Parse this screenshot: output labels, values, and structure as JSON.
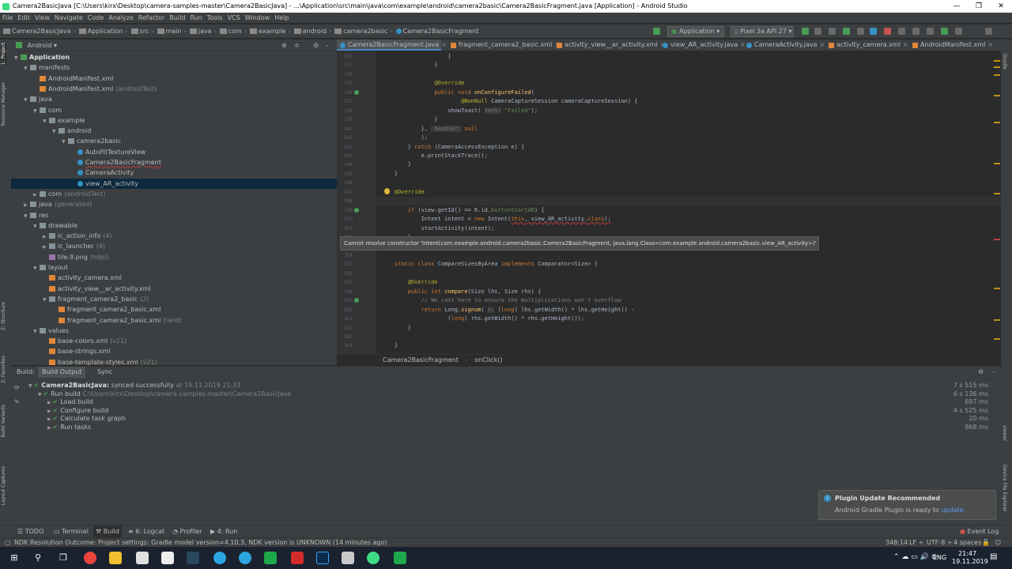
{
  "window": {
    "title": "Camera2BasicJava [C:\\Users\\kirx\\Desktop\\camera-samples-master\\Camera2BasicJava] - ...\\Application\\src\\main\\java\\com\\example\\android\\camera2basic\\Camera2BasicFragment.java [Application] - Android Studio",
    "minimize": "—",
    "maximize": "❐",
    "close": "✕"
  },
  "menu": [
    "File",
    "Edit",
    "View",
    "Navigate",
    "Code",
    "Analyze",
    "Refactor",
    "Build",
    "Run",
    "Tools",
    "VCS",
    "Window",
    "Help"
  ],
  "breadcrumbs": [
    "Camera2BasicJava",
    "Application",
    "src",
    "main",
    "java",
    "com",
    "example",
    "android",
    "camera2basic",
    "Camera2BasicFragment"
  ],
  "toolbar": {
    "run_config": "Application",
    "device": "Pixel 3a API 27"
  },
  "left_strip": {
    "project": "1: Project",
    "resource_manager": "Resource Manager",
    "structure": "Z: Structure",
    "favorites": "2: Favorites",
    "build_variants": "Build Variants",
    "layout_captures": "Layout Captures"
  },
  "right_strip": {
    "gradle": "Gradle",
    "viewer": "viewer",
    "device_file": "Device File Explorer"
  },
  "project": {
    "view": "Android",
    "tree": [
      {
        "label": "Application",
        "depth": 0,
        "bold": true,
        "arrow": "▼",
        "icon": "module"
      },
      {
        "label": "manifests",
        "depth": 1,
        "arrow": "▼",
        "icon": "folder"
      },
      {
        "label": "AndroidManifest.xml",
        "depth": 2,
        "icon": "xml"
      },
      {
        "label": "AndroidManifest.xml",
        "suffix": "(androidTest)",
        "depth": 2,
        "icon": "xml"
      },
      {
        "label": "java",
        "depth": 1,
        "arrow": "▼",
        "icon": "folder"
      },
      {
        "label": "com",
        "depth": 2,
        "arrow": "▼",
        "icon": "package"
      },
      {
        "label": "example",
        "depth": 3,
        "arrow": "▼",
        "icon": "package"
      },
      {
        "label": "android",
        "depth": 4,
        "arrow": "▼",
        "icon": "package"
      },
      {
        "label": "camera2basic",
        "depth": 5,
        "arrow": "▼",
        "icon": "package"
      },
      {
        "label": "AutoFitTextureView",
        "depth": 6,
        "icon": "class"
      },
      {
        "label": "Camera2BasicFragment",
        "depth": 6,
        "icon": "class",
        "underline": true
      },
      {
        "label": "CameraActivity",
        "depth": 6,
        "icon": "class"
      },
      {
        "label": "view_AR_activity",
        "depth": 6,
        "icon": "class",
        "selected": true
      },
      {
        "label": "com",
        "suffix": "(androidTest)",
        "depth": 2,
        "arrow": "▶",
        "icon": "package"
      },
      {
        "label": "java",
        "suffix": "(generated)",
        "depth": 1,
        "arrow": "▶",
        "icon": "folder"
      },
      {
        "label": "res",
        "depth": 1,
        "arrow": "▼",
        "icon": "folder"
      },
      {
        "label": "drawable",
        "depth": 2,
        "arrow": "▼",
        "icon": "folder"
      },
      {
        "label": "ic_action_info",
        "suffix": "(4)",
        "depth": 3,
        "arrow": "▶",
        "icon": "folder"
      },
      {
        "label": "ic_launcher",
        "suffix": "(4)",
        "depth": 3,
        "arrow": "▶",
        "icon": "folder"
      },
      {
        "label": "tile.9.png",
        "suffix": "(hdpi)",
        "depth": 3,
        "icon": "image"
      },
      {
        "label": "layout",
        "depth": 2,
        "arrow": "▼",
        "icon": "folder"
      },
      {
        "label": "activity_camera.xml",
        "depth": 3,
        "icon": "xml"
      },
      {
        "label": "activity_view__ar_activity.xml",
        "depth": 3,
        "icon": "xml"
      },
      {
        "label": "fragment_camera2_basic",
        "suffix": "(2)",
        "depth": 3,
        "arrow": "▼",
        "icon": "folder"
      },
      {
        "label": "fragment_camera2_basic.xml",
        "depth": 4,
        "icon": "xml"
      },
      {
        "label": "fragment_camera2_basic.xml",
        "suffix": "(land)",
        "depth": 4,
        "icon": "xml"
      },
      {
        "label": "values",
        "depth": 2,
        "arrow": "▼",
        "icon": "folder"
      },
      {
        "label": "base-colors.xml",
        "suffix": "(v21)",
        "depth": 3,
        "icon": "xml"
      },
      {
        "label": "base-strings.xml",
        "depth": 3,
        "icon": "xml"
      },
      {
        "label": "base-template-styles.xml",
        "suffix": "(v21)",
        "depth": 3,
        "icon": "xml"
      }
    ]
  },
  "editor": {
    "tabs": [
      "Camera2BasicFragment.java",
      "fragment_camera2_basic.xml",
      "activity_view__ar_activity.xml",
      "view_AR_activity.java",
      "CameraActivity.java",
      "activity_camera.xml",
      "AndroidManifest.xml"
    ],
    "line_numbers": [
      "332",
      "333",
      "334",
      "335",
      "336",
      "337",
      "338",
      "339",
      "340",
      "341",
      "342",
      "343",
      "344",
      "345",
      "346",
      "347",
      "348",
      "349",
      "350",
      "351",
      "352",
      "353",
      "354",
      "355",
      "356",
      "357",
      "358",
      "359",
      "360",
      "361",
      "362",
      "363",
      "364"
    ],
    "lines": [
      [
        {
          "t": "                    }"
        }
      ],
      [
        {
          "t": "                }"
        }
      ],
      [
        {
          "t": ""
        }
      ],
      [
        {
          "t": "                ",
          "c": ""
        },
        {
          "t": "@Override",
          "c": "an"
        }
      ],
      [
        {
          "t": "                "
        },
        {
          "t": "public void ",
          "c": "kw"
        },
        {
          "t": "onConfigureFailed",
          "c": "fn"
        },
        {
          "t": "("
        }
      ],
      [
        {
          "t": "                        "
        },
        {
          "t": "@NonNull",
          "c": "an"
        },
        {
          "t": " CameraCaptureSession cameraCaptureSession) {"
        }
      ],
      [
        {
          "t": "                    showToast( "
        },
        {
          "t": "text:",
          "c": "hint"
        },
        {
          "t": " "
        },
        {
          "t": "\"Failed\"",
          "c": "st"
        },
        {
          "t": ");"
        }
      ],
      [
        {
          "t": "                }"
        }
      ],
      [
        {
          "t": "            }, "
        },
        {
          "t": " handler:",
          "c": "hint"
        },
        {
          "t": " "
        },
        {
          "t": "null",
          "c": "kw"
        }
      ],
      [
        {
          "t": "            );"
        }
      ],
      [
        {
          "t": "        } "
        },
        {
          "t": "catch ",
          "c": "kw"
        },
        {
          "t": "(CameraAccessException e) {"
        }
      ],
      [
        {
          "t": "            e.printStackTrace();"
        }
      ],
      [
        {
          "t": "        }"
        }
      ],
      [
        {
          "t": "    }"
        }
      ],
      [
        {
          "t": ""
        }
      ],
      [
        {
          "t": "    "
        },
        {
          "t": "@Override",
          "c": "an"
        }
      ],
      [
        {
          "t": "    "
        },
        {
          "t": "public void ",
          "c": "kw"
        },
        {
          "t": "onClick",
          "c": "fn"
        },
        {
          "t": "(View view) {"
        }
      ],
      [
        {
          "t": "        "
        },
        {
          "t": "if ",
          "c": "kw"
        },
        {
          "t": "(view.getId() == R.id."
        },
        {
          "t": "buttonStartAR",
          "c": "st"
        },
        {
          "t": ") {"
        }
      ],
      [
        {
          "t": "            Intent intent = "
        },
        {
          "t": "new ",
          "c": "kw"
        },
        {
          "t": "Intent("
        },
        {
          "t": "this",
          "c": "kw"
        },
        {
          "t": ", view_AR_activity."
        },
        {
          "t": "class",
          "c": "kw"
        },
        {
          "t": ");"
        }
      ],
      [
        {
          "t": "            startActivity(intent);"
        }
      ],
      [
        {
          "t": "        }"
        }
      ],
      [
        {
          "t": "    }"
        }
      ],
      [
        {
          "t": ""
        }
      ],
      [
        {
          "t": "    "
        },
        {
          "t": "static class ",
          "c": "kw"
        },
        {
          "t": "CompareSizesByArea "
        },
        {
          "t": "implements ",
          "c": "kw"
        },
        {
          "t": "Comparator<Size> {"
        }
      ],
      [
        {
          "t": ""
        }
      ],
      [
        {
          "t": "        "
        },
        {
          "t": "@Override",
          "c": "an"
        }
      ],
      [
        {
          "t": "        "
        },
        {
          "t": "public int ",
          "c": "kw"
        },
        {
          "t": "compare",
          "c": "fn"
        },
        {
          "t": "(Size lhs, Size rhs) {"
        }
      ],
      [
        {
          "t": "            "
        },
        {
          "t": "// We cast here to ensure the multiplications won't overflow",
          "c": "cm"
        }
      ],
      [
        {
          "t": "            "
        },
        {
          "t": "return ",
          "c": "kw"
        },
        {
          "t": "Long."
        },
        {
          "t": "signum",
          "c": "fn"
        },
        {
          "t": "( "
        },
        {
          "t": "x:",
          "c": "hint"
        },
        {
          "t": " ("
        },
        {
          "t": "long",
          "c": "kw"
        },
        {
          "t": ") lhs.getWidth() * lhs.getHeight() -"
        }
      ],
      [
        {
          "t": "                    ("
        },
        {
          "t": "long",
          "c": "kw"
        },
        {
          "t": ") rhs.getWidth() * rhs.getHeight());"
        }
      ],
      [
        {
          "t": "        }"
        }
      ],
      [
        {
          "t": ""
        }
      ],
      [
        {
          "t": "    }"
        }
      ]
    ],
    "tooltip": "Cannot resolve constructor 'Intent(com.example.android.camera2basic.Camera2BasicFragment, java.lang.Class<com.example.android.camera2basic.view_AR_activity>)'",
    "breadcrumb": [
      "Camera2BasicFragment",
      "onClick()"
    ]
  },
  "build": {
    "tabs": [
      "Build:",
      "Build Output",
      "Sync"
    ],
    "rows": [
      {
        "label": "Camera2BasicJava:",
        "rest": " synced successfully",
        "gray": " at 19.11.2019 21:33",
        "depth": 0,
        "time": "7 s 515 ms",
        "bold": true
      },
      {
        "label": "Run build",
        "gray": " C:\\Users\\kirx\\Desktop\\camera-samples-master\\Camera2BasicJava",
        "depth": 1,
        "time": "6 s 136 ms"
      },
      {
        "label": "Load build",
        "depth": 2,
        "time": "697 ms"
      },
      {
        "label": "Configure build",
        "depth": 2,
        "time": "4 s 525 ms"
      },
      {
        "label": "Calculate task graph",
        "depth": 2,
        "time": "20 ms"
      },
      {
        "label": "Run tasks",
        "depth": 2,
        "time": "868 ms"
      }
    ]
  },
  "notification": {
    "title": "Plugin Update Recommended",
    "body": "Android Gradle Plugin is ready to",
    "link": "update."
  },
  "bottom_tools": [
    "TODO",
    "Terminal",
    "Build",
    "6: Logcat",
    "Profiler",
    "4: Run"
  ],
  "event_log": "Event Log",
  "status": {
    "message": "NDK Resolution Outcome: Project settings: Gradle model version=4.10.3, NDK version is UNKNOWN (14 minutes ago)",
    "position": "348:14",
    "line_sep": "LF ÷",
    "encoding": "UTF-8 ÷",
    "indent": "4 spaces ÷"
  },
  "taskbar": {
    "lang": "ENG",
    "time": "21:47",
    "date": "19.11.2019"
  }
}
